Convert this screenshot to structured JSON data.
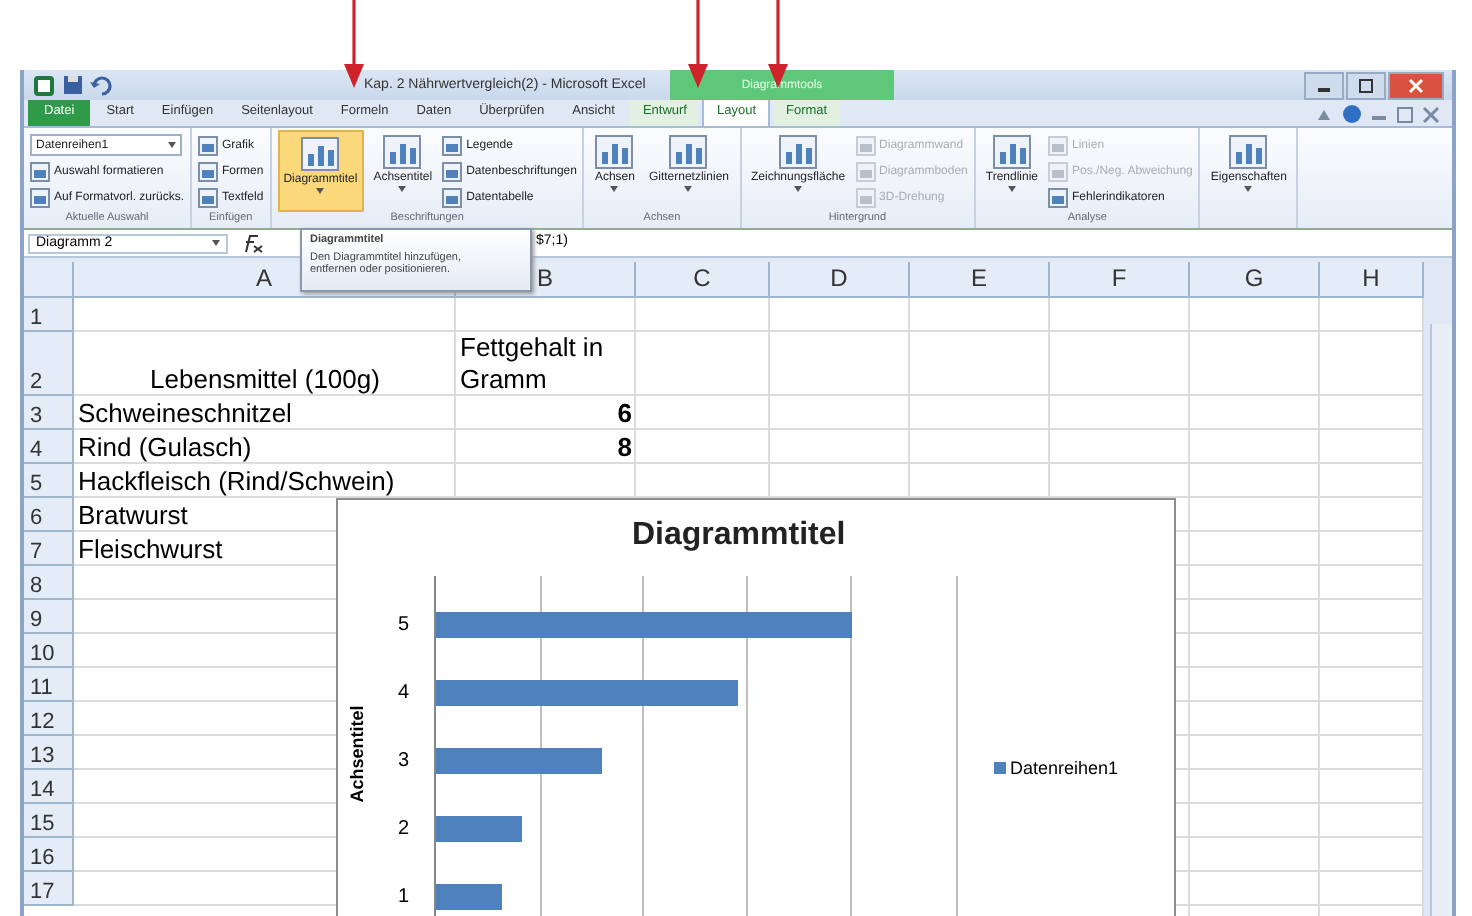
{
  "window": {
    "title": "Kap. 2 Nährwertvergleich(2) - Microsoft Excel",
    "context_tab": "Diagrammtools"
  },
  "tabs": [
    {
      "label": "Datei",
      "kind": "file",
      "selected": false
    },
    {
      "label": "Start",
      "kind": "tab",
      "selected": false
    },
    {
      "label": "Einfügen",
      "kind": "tab",
      "selected": false
    },
    {
      "label": "Seitenlayout",
      "kind": "tab",
      "selected": false
    },
    {
      "label": "Formeln",
      "kind": "tab",
      "selected": false
    },
    {
      "label": "Daten",
      "kind": "tab",
      "selected": false
    },
    {
      "label": "Überprüfen",
      "kind": "tab",
      "selected": false
    },
    {
      "label": "Ansicht",
      "kind": "tab",
      "selected": false
    },
    {
      "label": "Entwurf",
      "kind": "context",
      "selected": false
    },
    {
      "label": "Layout",
      "kind": "context",
      "selected": true
    },
    {
      "label": "Format",
      "kind": "context",
      "selected": false
    }
  ],
  "ribbon": [
    {
      "label": "Aktuelle Auswahl",
      "items": [
        {
          "kind": "selector",
          "label": "Datenreihen1",
          "disabled": false,
          "highlighted": false
        },
        {
          "kind": "small",
          "label": "Auswahl formatieren",
          "disabled": false,
          "highlighted": false
        },
        {
          "kind": "small",
          "label": "Auf Formatvorl. zurücks.",
          "disabled": false,
          "highlighted": false
        }
      ]
    },
    {
      "label": "Einfügen",
      "items": [
        {
          "kind": "small",
          "label": "Grafik",
          "disabled": false,
          "highlighted": false
        },
        {
          "kind": "small",
          "label": "Formen",
          "disabled": false,
          "highlighted": false
        },
        {
          "kind": "small",
          "label": "Textfeld",
          "disabled": false,
          "highlighted": false
        }
      ]
    },
    {
      "label": "Beschriftungen",
      "items": [
        {
          "kind": "large",
          "label": "Diagrammtitel",
          "disabled": false,
          "highlighted": true
        },
        {
          "kind": "large",
          "label": "Achsentitel",
          "disabled": false,
          "highlighted": false
        },
        {
          "kind": "small",
          "label": "Legende",
          "disabled": false,
          "highlighted": false
        },
        {
          "kind": "small",
          "label": "Datenbeschriftungen",
          "disabled": false,
          "highlighted": false
        },
        {
          "kind": "small",
          "label": "Datentabelle",
          "disabled": false,
          "highlighted": false
        }
      ]
    },
    {
      "label": "Achsen",
      "items": [
        {
          "kind": "large",
          "label": "Achsen",
          "disabled": false,
          "highlighted": false
        },
        {
          "kind": "large",
          "label": "Gitternetzlinien",
          "disabled": false,
          "highlighted": false
        }
      ]
    },
    {
      "label": "Hintergrund",
      "items": [
        {
          "kind": "large",
          "label": "Zeichnungsfläche",
          "disabled": false,
          "highlighted": false
        },
        {
          "kind": "small",
          "label": "Diagrammwand",
          "disabled": true,
          "highlighted": false
        },
        {
          "kind": "small",
          "label": "Diagrammboden",
          "disabled": true,
          "highlighted": false
        },
        {
          "kind": "small",
          "label": "3D-Drehung",
          "disabled": true,
          "highlighted": false
        }
      ]
    },
    {
      "label": "Analyse",
      "items": [
        {
          "kind": "large",
          "label": "Trendlinie",
          "disabled": false,
          "highlighted": false
        },
        {
          "kind": "small",
          "label": "Linien",
          "disabled": true,
          "highlighted": false
        },
        {
          "kind": "small",
          "label": "Pos./Neg. Abweichung",
          "disabled": true,
          "highlighted": false
        },
        {
          "kind": "small",
          "label": "Fehlerindikatoren",
          "disabled": false,
          "highlighted": false
        }
      ]
    },
    {
      "items": [
        {
          "kind": "large",
          "label": "Eigenschaften",
          "disabled": false,
          "highlighted": false
        }
      ]
    }
  ],
  "formula_bar": {
    "name_box": "Diagramm 2",
    "formula": "$7;1)"
  },
  "tooltip": {
    "title": "Diagrammtitel",
    "text": "Den Diagrammtitel hinzufügen, entfernen oder positionieren."
  },
  "columns": [
    "A",
    "B",
    "C",
    "D",
    "E",
    "F",
    "G",
    "H"
  ],
  "rows": [
    {
      "number": "1"
    },
    {
      "number": "2",
      "a": "Lebensmittel (100g)",
      "b": "Fettgehalt in Gramm"
    },
    {
      "number": "3",
      "a": "Schweineschnitzel",
      "b": "6"
    },
    {
      "number": "4",
      "a": "Rind (Gulasch)",
      "b": "8"
    },
    {
      "number": "5",
      "a": "Hackfleisch (Rind/Schwein)"
    },
    {
      "number": "6",
      "a": "Bratwurst"
    },
    {
      "number": "7",
      "a": "Fleischwurst"
    },
    {
      "number": "8"
    },
    {
      "number": "9"
    },
    {
      "number": "10"
    },
    {
      "number": "11"
    },
    {
      "number": "12"
    },
    {
      "number": "13"
    },
    {
      "number": "14"
    },
    {
      "number": "15"
    },
    {
      "number": "16"
    },
    {
      "number": "17"
    }
  ],
  "chart": {
    "title": "Diagrammtitel",
    "axis_title": "Achsentitel",
    "categories": [
      "5",
      "4",
      "3",
      "2",
      "1"
    ],
    "legend": "Datenreihen1"
  }
}
